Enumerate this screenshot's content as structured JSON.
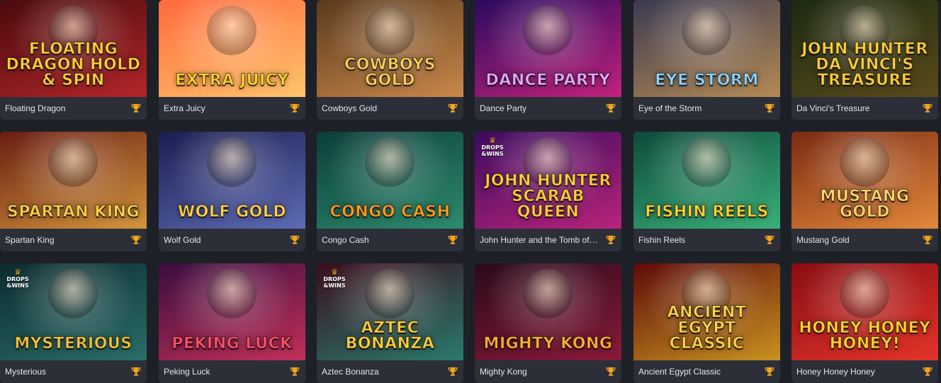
{
  "accent_color": "#f3a51e",
  "background_color": "#1e2027",
  "card_color": "#2c2f38",
  "games": [
    {
      "title": "Floating Dragon",
      "logo": "Floating Dragon Hold & Spin",
      "bg": [
        "#4a0a0c",
        "#b3262a"
      ],
      "logo_color": "#ffcf3a",
      "badge": false,
      "favorite_icon": "trophy-icon"
    },
    {
      "title": "Extra Juicy",
      "logo": "Extra Juicy",
      "bg": [
        "#ff6a3d",
        "#ffc46b"
      ],
      "logo_color": "#ffd52b",
      "badge": false,
      "favorite_icon": "trophy-icon"
    },
    {
      "title": "Cowboys Gold",
      "logo": "Cowboys Gold",
      "bg": [
        "#5b3a1d",
        "#c9884a"
      ],
      "logo_color": "#ffcf5a",
      "badge": false,
      "favorite_icon": "trophy-icon"
    },
    {
      "title": "Dance Party",
      "logo": "Dance Party",
      "bg": [
        "#2a0a5e",
        "#c3227d"
      ],
      "logo_color": "#e6a8ff",
      "badge": false,
      "favorite_icon": "trophy-icon"
    },
    {
      "title": "Eye of the Storm",
      "logo": "Eye Storm",
      "bg": [
        "#3b3a52",
        "#b58a52"
      ],
      "logo_color": "#8fd3ff",
      "badge": false,
      "favorite_icon": "trophy-icon"
    },
    {
      "title": "Da Vinci's Treasure",
      "logo": "John Hunter Da Vinci's Treasure",
      "bg": [
        "#1c2a12",
        "#5a4a1a"
      ],
      "logo_color": "#ffcf3a",
      "badge": false,
      "favorite_icon": "trophy-icon"
    },
    {
      "title": "Spartan King",
      "logo": "Spartan King",
      "bg": [
        "#6b1d12",
        "#d3953d"
      ],
      "logo_color": "#ffd24a",
      "badge": false,
      "favorite_icon": "trophy-icon"
    },
    {
      "title": "Wolf Gold",
      "logo": "Wolf Gold",
      "bg": [
        "#1a1d4e",
        "#5e6bb5"
      ],
      "logo_color": "#ffd24a",
      "badge": false,
      "favorite_icon": "trophy-icon"
    },
    {
      "title": "Congo Cash",
      "logo": "Congo Cash",
      "bg": [
        "#0b3d3a",
        "#2e8b6e"
      ],
      "logo_color": "#ff9a1f",
      "badge": false,
      "favorite_icon": "trophy-icon"
    },
    {
      "title": "John Hunter and the Tomb of the Scarab Queen",
      "logo": "John Hunter Scarab Queen",
      "bg": [
        "#3a0b5e",
        "#b8247a"
      ],
      "logo_color": "#ffcf3a",
      "badge": true,
      "favorite_icon": "trophy-icon"
    },
    {
      "title": "Fishin Reels",
      "logo": "Fishin Reels",
      "bg": [
        "#0d4a3b",
        "#3bb07a"
      ],
      "logo_color": "#ffd22e",
      "badge": false,
      "favorite_icon": "trophy-icon"
    },
    {
      "title": "Mustang Gold",
      "logo": "Mustang Gold",
      "bg": [
        "#7a2a12",
        "#e3883a"
      ],
      "logo_color": "#ffd66a",
      "badge": false,
      "favorite_icon": "trophy-icon"
    },
    {
      "title": "Mysterious",
      "logo": "Mysterious",
      "bg": [
        "#0b2a2e",
        "#2b6e6a"
      ],
      "logo_color": "#f3c23a",
      "badge": true,
      "favorite_icon": "trophy-icon"
    },
    {
      "title": "Peking Luck",
      "logo": "Peking Luck",
      "bg": [
        "#3a0d3e",
        "#c3305a"
      ],
      "logo_color": "#ff4f6a",
      "badge": false,
      "favorite_icon": "trophy-icon"
    },
    {
      "title": "Aztec Bonanza",
      "logo": "Aztec Bonanza",
      "bg": [
        "#3a0d1c",
        "#2a7a6e"
      ],
      "logo_color": "#ffcf3a",
      "badge": true,
      "favorite_icon": "trophy-icon"
    },
    {
      "title": "Mighty Kong",
      "logo": "Mighty Kong",
      "bg": [
        "#2a0a1a",
        "#8a1a3a"
      ],
      "logo_color": "#ffb02e",
      "badge": false,
      "favorite_icon": "trophy-icon"
    },
    {
      "title": "Ancient Egypt Classic",
      "logo": "Ancient Egypt Classic",
      "bg": [
        "#5e0a0a",
        "#c9921f"
      ],
      "logo_color": "#ffd24a",
      "badge": false,
      "favorite_icon": "trophy-icon"
    },
    {
      "title": "Honey Honey Honey",
      "logo": "Honey Honey Honey!",
      "bg": [
        "#8a0d12",
        "#e3342a"
      ],
      "logo_color": "#ffd22e",
      "badge": false,
      "favorite_icon": "trophy-icon"
    }
  ],
  "badge_text": {
    "line1": "DROPS",
    "line2": "&WINS"
  }
}
